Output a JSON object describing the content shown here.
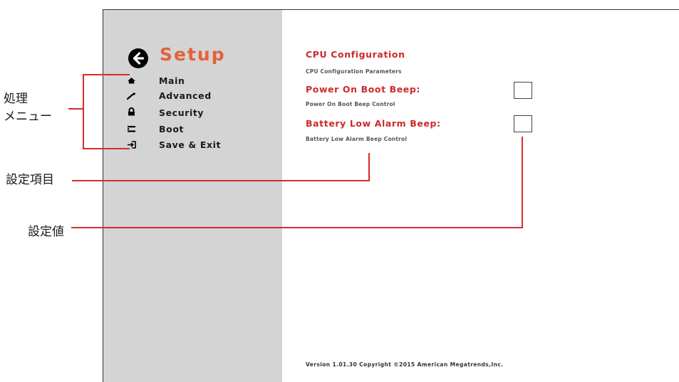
{
  "sidebar": {
    "title": "Setup",
    "back_icon": "arrow-left-circle-icon",
    "items": [
      {
        "label": "Main",
        "icon": "home-icon"
      },
      {
        "label": "Advanced",
        "icon": "wrench-icon"
      },
      {
        "label": "Security",
        "icon": "lock-icon"
      },
      {
        "label": "Boot",
        "icon": "boot-drive-icon"
      },
      {
        "label": "Save & Exit",
        "icon": "exit-icon"
      }
    ]
  },
  "main": {
    "section_title": "CPU Configuration",
    "section_desc": "CPU Configuration Parameters",
    "settings": [
      {
        "title": "Power On Boot Beep:",
        "desc": "Power On Boot Beep Control"
      },
      {
        "title": "Battery Low Alarm Beep:",
        "desc": "Battery Low Alarm Beep Control"
      }
    ],
    "footer": "Version 1.01.30 Copyright ©2015 American Megatrends,Inc."
  },
  "callouts": {
    "menu_line1": "処理",
    "menu_line2": "メニュー",
    "settings_item": "設定項目",
    "settings_value": "設定値"
  },
  "colors": {
    "accent": "#e5603a",
    "setting_title": "#cc2a2a",
    "callout_line": "#d62b2b",
    "sidebar_bg": "#d4d4d4"
  }
}
